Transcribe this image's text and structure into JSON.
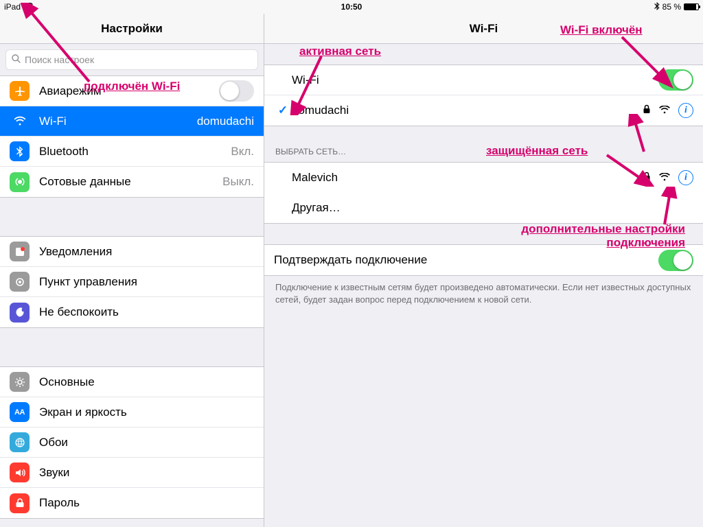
{
  "statusbar": {
    "device": "iPad",
    "time": "10:50",
    "battery_pct": "85 %",
    "battery_level": 85
  },
  "sidebar": {
    "title": "Настройки",
    "search_placeholder": "Поиск настроек",
    "groups": [
      [
        {
          "icon": "airplane",
          "color": "#ff9500",
          "label": "Авиарежим",
          "switch": false
        },
        {
          "icon": "wifi",
          "color": "#007aff",
          "label": "Wi-Fi",
          "detail": "domudachi",
          "selected": true
        },
        {
          "icon": "bluetooth",
          "color": "#007aff",
          "label": "Bluetooth",
          "detail": "Вкл."
        },
        {
          "icon": "cellular",
          "color": "#4cd964",
          "label": "Сотовые данные",
          "detail": "Выкл."
        }
      ],
      [
        {
          "icon": "notifications",
          "color": "#9b9b9b",
          "label": "Уведомления"
        },
        {
          "icon": "control-center",
          "color": "#9b9b9b",
          "label": "Пункт управления"
        },
        {
          "icon": "dnd",
          "color": "#5856d6",
          "label": "Не беспокоить"
        }
      ],
      [
        {
          "icon": "general",
          "color": "#9b9b9b",
          "label": "Основные"
        },
        {
          "icon": "display",
          "color": "#007aff",
          "label": "Экран и яркость"
        },
        {
          "icon": "wallpaper",
          "color": "#34aadc",
          "label": "Обои"
        },
        {
          "icon": "sounds",
          "color": "#ff3b30",
          "label": "Звуки"
        },
        {
          "icon": "passcode",
          "color": "#ff3b30",
          "label": "Пароль"
        }
      ]
    ]
  },
  "detail": {
    "title": "Wi-Fi",
    "wifi_label": "Wi-Fi",
    "wifi_on": true,
    "connected": {
      "name": "domudachi",
      "locked": true
    },
    "choose_header": "ВЫБРАТЬ СЕТЬ…",
    "networks": [
      {
        "name": "Malevich",
        "locked": true
      }
    ],
    "other_label": "Другая…",
    "ask_label": "Подтверждать подключение",
    "ask_on": true,
    "ask_footer": "Подключение к известным сетям будет произведено автоматически. Если нет известных доступных сетей, будет задан вопрос перед подключением к новой сети."
  },
  "annotations": {
    "a1": "подключён Wi-Fi",
    "a2": "активная сеть",
    "a3": "Wi-Fi включён",
    "a4": "защищённая сеть",
    "a5": "дополнительные настройки подключения"
  }
}
